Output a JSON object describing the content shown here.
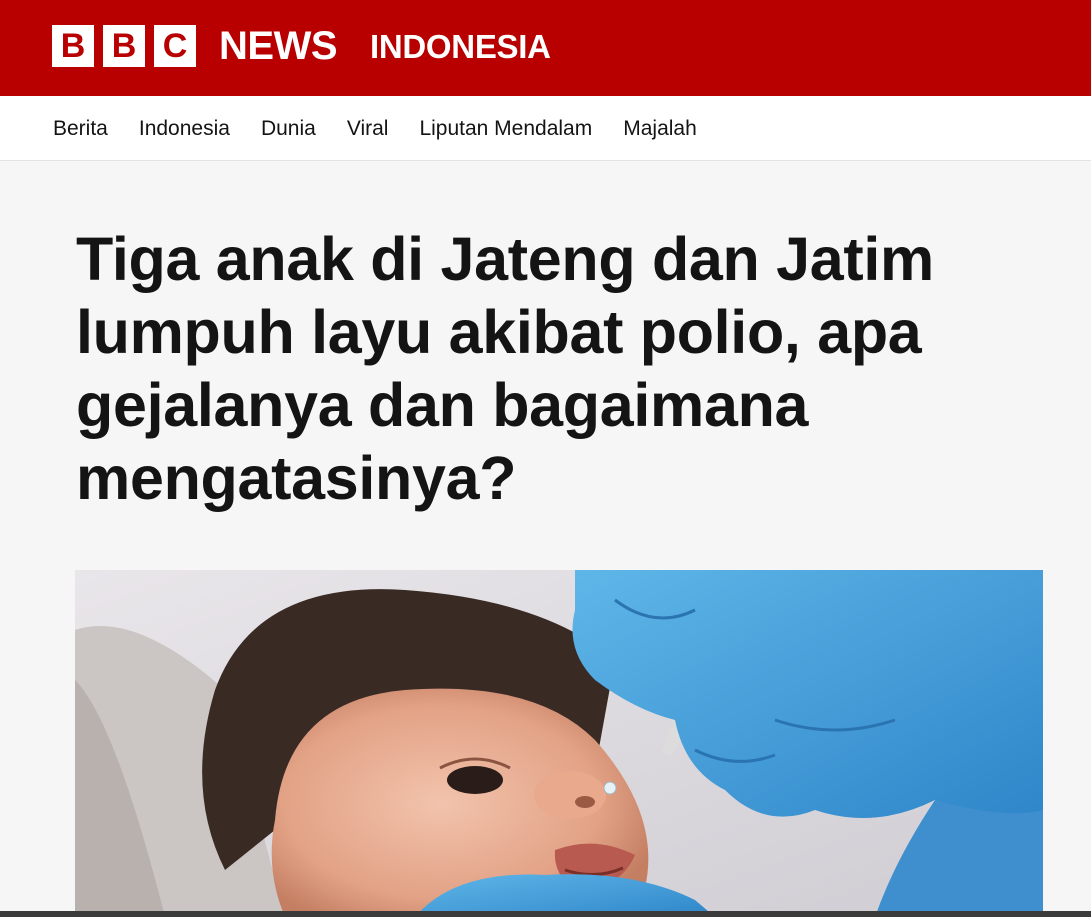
{
  "brand": {
    "letters": [
      "B",
      "B",
      "C"
    ],
    "news": "NEWS",
    "service": "INDONESIA",
    "color": "#b80000"
  },
  "nav": {
    "items": [
      {
        "label": "Berita"
      },
      {
        "label": "Indonesia"
      },
      {
        "label": "Dunia"
      },
      {
        "label": "Viral"
      },
      {
        "label": "Liputan Mendalam"
      },
      {
        "label": "Majalah"
      }
    ]
  },
  "article": {
    "headline": "Tiga anak di Jateng dan Jatim lumpuh layu akibat polio, apa gejalanya dan bagaimana mengatasinya?",
    "image_description": "photo-baby-receiving-oral-polio-vaccine-drops"
  }
}
